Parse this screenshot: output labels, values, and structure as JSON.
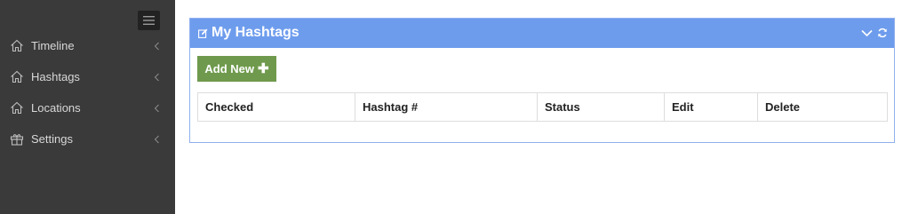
{
  "sidebar": {
    "items": [
      {
        "label": "Timeline",
        "icon": "home-icon"
      },
      {
        "label": "Hashtags",
        "icon": "home-icon"
      },
      {
        "label": "Locations",
        "icon": "home-icon"
      },
      {
        "label": "Settings",
        "icon": "gift-icon"
      }
    ]
  },
  "panel": {
    "title": "My Hashtags",
    "add_button": "Add New",
    "table": {
      "columns": [
        "Checked",
        "Hashtag #",
        "Status",
        "Edit",
        "Delete"
      ]
    }
  },
  "colors": {
    "sidebar_bg": "#3a3a3a",
    "panel_header": "#6e9ced",
    "add_button": "#6f9a4d"
  }
}
